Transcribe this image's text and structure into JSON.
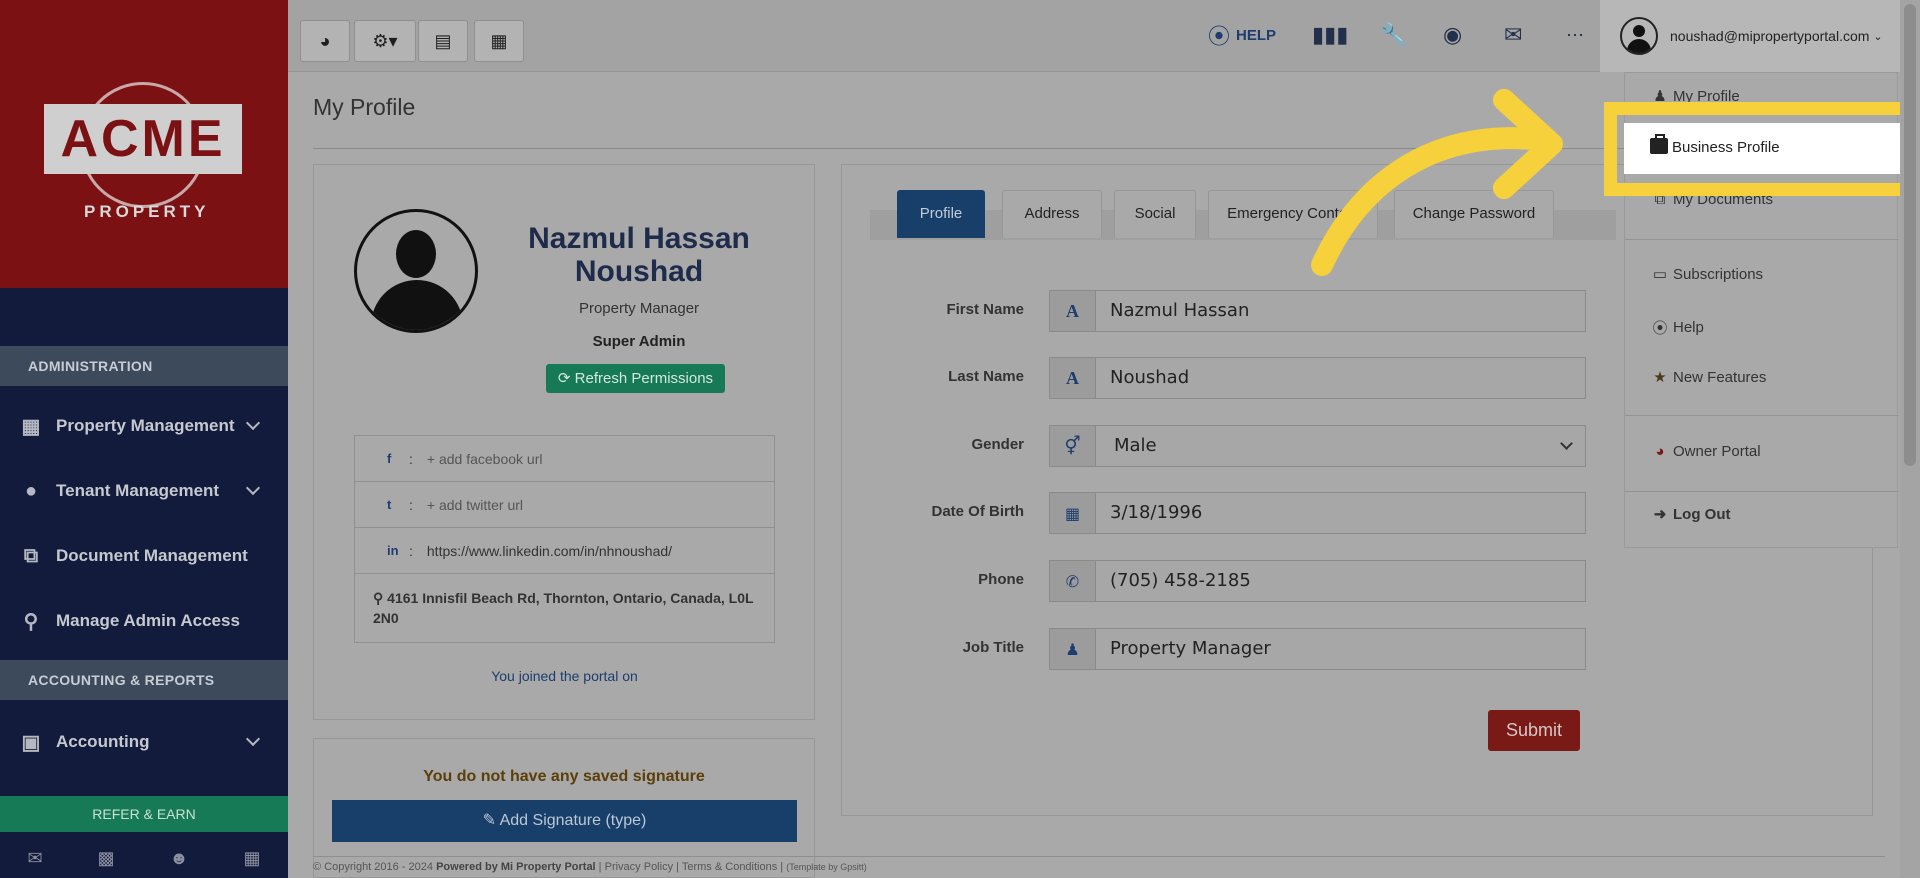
{
  "brand": {
    "logo_text": "ACME",
    "logo_sub": "PROPERTY"
  },
  "sidebar": {
    "section_admin": "ADMINISTRATION",
    "section_accounting": "ACCOUNTING & REPORTS",
    "items": [
      {
        "label": "Property Management",
        "icon": "building-icon"
      },
      {
        "label": "Tenant Management",
        "icon": "users-icon"
      },
      {
        "label": "Document Management",
        "icon": "documents-icon"
      },
      {
        "label": "Manage Admin Access",
        "icon": "key-icon"
      },
      {
        "label": "Accounting",
        "icon": "money-icon"
      }
    ],
    "refer": "REFER & EARN"
  },
  "topbar": {
    "help_label": "HELP",
    "user_email": "noushad@mipropertyportal.com"
  },
  "page": {
    "title": "My Profile"
  },
  "profile": {
    "name": "Nazmul Hassan Noushad",
    "role": "Property Manager",
    "access": "Super Admin",
    "refresh_label": "Refresh Permissions",
    "facebook": "add facebook url",
    "twitter": "add twitter url",
    "linkedin": "https://www.linkedin.com/in/nhnoushad/",
    "address": "4161 Innisfil Beach Rd, Thornton, Ontario, Canada, L0L 2N0",
    "joined": "You joined the portal on",
    "signature_msg": "You do not have any saved signature",
    "signature_btn": "Add Signature (type)"
  },
  "tabs": [
    "Profile",
    "Address",
    "Social",
    "Emergency Contact",
    "Change Password"
  ],
  "form": {
    "first_name_label": "First Name",
    "first_name_value": "Nazmul Hassan",
    "last_name_label": "Last Name",
    "last_name_value": "Noushad",
    "gender_label": "Gender",
    "gender_value": "Male",
    "dob_label": "Date Of Birth",
    "dob_value": "3/18/1996",
    "phone_label": "Phone",
    "phone_value": "(705) 458-2185",
    "job_label": "Job Title",
    "job_value": "Property Manager",
    "submit": "Submit"
  },
  "dropdown": {
    "my_profile": "My Profile",
    "business_profile": "Business Profile",
    "my_documents": "My Documents",
    "subscriptions": "Subscriptions",
    "help": "Help",
    "new_features": "New Features",
    "owner_portal": "Owner Portal",
    "log_out": "Log Out"
  },
  "footer": {
    "copyright": "© Copyright 2016 - 2024",
    "powered": "Powered by Mi Property Portal",
    "privacy": "Privacy Policy",
    "terms": "Terms & Conditions",
    "template": "(Template by Gpsitt)"
  },
  "colors": {
    "highlight": "#f7d13c",
    "primary": "#183f6a",
    "danger": "#7a1a17",
    "success": "#157a55"
  }
}
